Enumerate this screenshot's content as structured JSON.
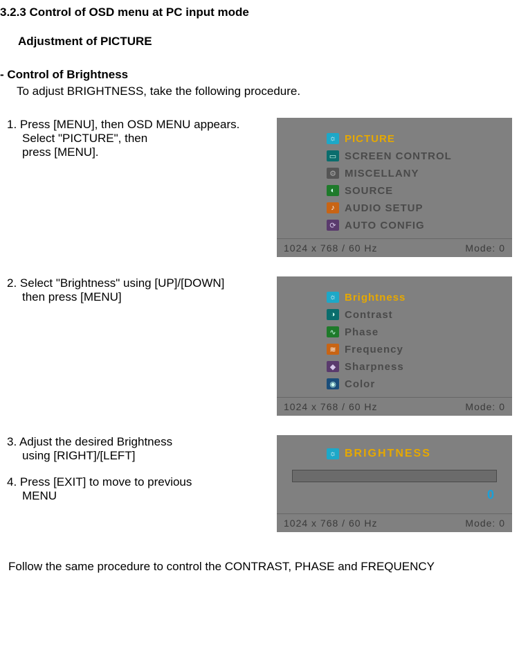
{
  "section": {
    "number_title": "3.2.3  Control of OSD menu at PC input mode",
    "sub_title": "Adjustment of PICTURE",
    "line1": "- Control of Brightness",
    "line2": "To adjust BRIGHTNESS, take the following procedure."
  },
  "steps": {
    "s1a": "1. Press [MENU], then OSD MENU appears.",
    "s1b": "Select \"PICTURE\", then",
    "s1c": "press [MENU].",
    "s2a": "2. Select \"Brightness\" using [UP]/[DOWN]",
    "s2b": "then press [MENU]",
    "s3a": "3. Adjust the desired Brightness",
    "s3b": "using [RIGHT]/[LEFT]",
    "s4a": "4. Press [EXIT] to move to previous",
    "s4b": "MENU"
  },
  "footer": "Follow the same procedure to control the CONTRAST, PHASE and FREQUENCY",
  "osd1": {
    "items": [
      {
        "icon": "ic-cyan",
        "glyph": "☼",
        "label": "PICTURE",
        "cls": "sel"
      },
      {
        "icon": "ic-teal",
        "glyph": "▭",
        "label": "SCREEN CONTROL",
        "cls": "dim"
      },
      {
        "icon": "ic-gray",
        "glyph": "⚙",
        "label": "MISCELLANY",
        "cls": "dim"
      },
      {
        "icon": "ic-green",
        "glyph": "◐",
        "label": "SOURCE",
        "cls": "dim"
      },
      {
        "icon": "ic-orange",
        "glyph": "♪",
        "label": "AUDIO SETUP",
        "cls": "dim"
      },
      {
        "icon": "ic-purple",
        "glyph": "⟳",
        "label": "AUTO CONFIG",
        "cls": "dim"
      }
    ],
    "status_left": "1024  x   768  /   60  Hz",
    "status_right": "Mode:   0"
  },
  "osd2": {
    "items": [
      {
        "icon": "ic-cyan",
        "glyph": "☼",
        "label": "Brightness",
        "cls": "sel"
      },
      {
        "icon": "ic-teal",
        "glyph": "◑",
        "label": "Contrast",
        "cls": "dim"
      },
      {
        "icon": "ic-green",
        "glyph": "∿",
        "label": "Phase",
        "cls": "dim"
      },
      {
        "icon": "ic-orange",
        "glyph": "≋",
        "label": "Frequency",
        "cls": "dim"
      },
      {
        "icon": "ic-purple",
        "glyph": "◆",
        "label": "Sharpness",
        "cls": "dim"
      },
      {
        "icon": "ic-blue",
        "glyph": "◉",
        "label": "Color",
        "cls": "dim"
      }
    ],
    "status_left": "1024  x   768  /   60  Hz",
    "status_right": "Mode:   0"
  },
  "osd3": {
    "title_icon": "ic-cyan",
    "title_glyph": "☼",
    "title_label": "BRIGHTNESS",
    "value": "0",
    "status_left": "1024  x   768  /   60  Hz",
    "status_right": "Mode:   0"
  }
}
